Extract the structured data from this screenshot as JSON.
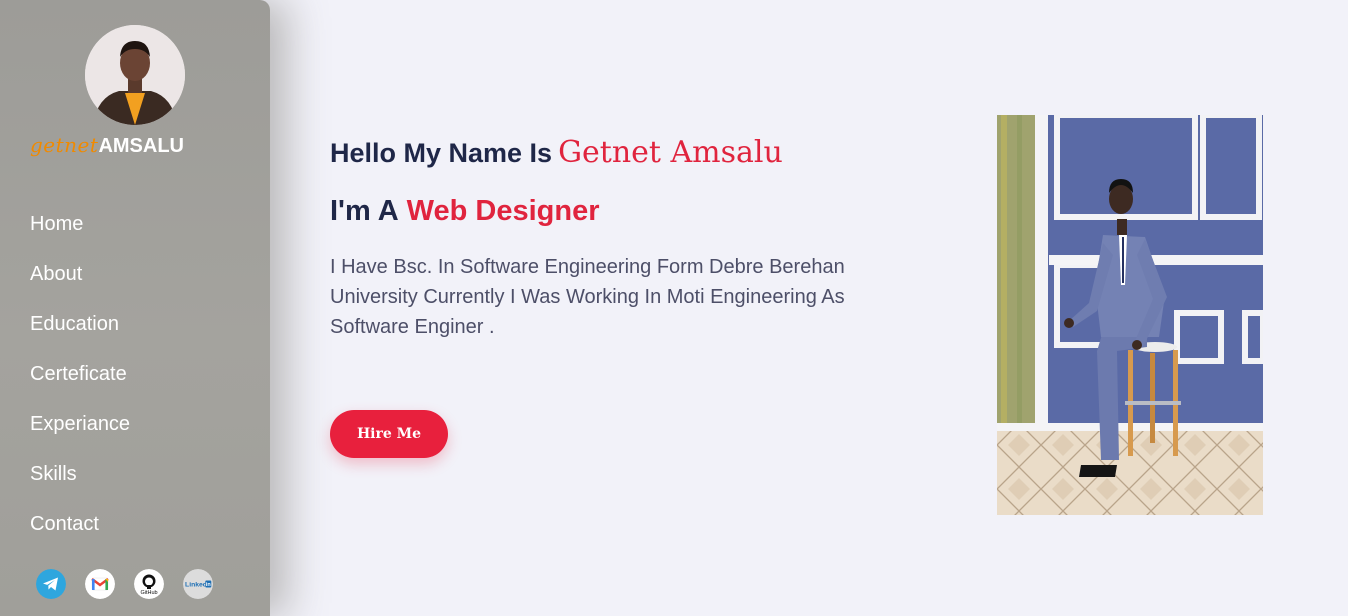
{
  "sidebar": {
    "brand_first": "getnet",
    "brand_last": "AMSALU",
    "nav": [
      {
        "label": "Home"
      },
      {
        "label": "About"
      },
      {
        "label": "Education"
      },
      {
        "label": "Certeficate"
      },
      {
        "label": "Experiance"
      },
      {
        "label": "Skills"
      },
      {
        "label": "Contact"
      }
    ],
    "socials": [
      {
        "icon": "telegram-icon"
      },
      {
        "icon": "gmail-icon"
      },
      {
        "icon": "github-icon",
        "label": "GitHub"
      },
      {
        "icon": "linkedin-icon",
        "label": "LinkedIn"
      }
    ]
  },
  "hero": {
    "greeting": "Hello My Name Is",
    "name": "Getnet Amsalu",
    "role_prefix": "I'm A",
    "role": "Web Designer",
    "bio": "I Have Bsc. In Software Engineering Form Debre Berehan University Currently I Was Working In Moti Engineering As Software Enginer .",
    "hire_label": "Hire Me"
  },
  "colors": {
    "accent": "#e0243e",
    "brand_orange": "#f08a00",
    "heading": "#1f2748",
    "sidebar": "#a09f9a",
    "background": "#f2f2f9"
  }
}
